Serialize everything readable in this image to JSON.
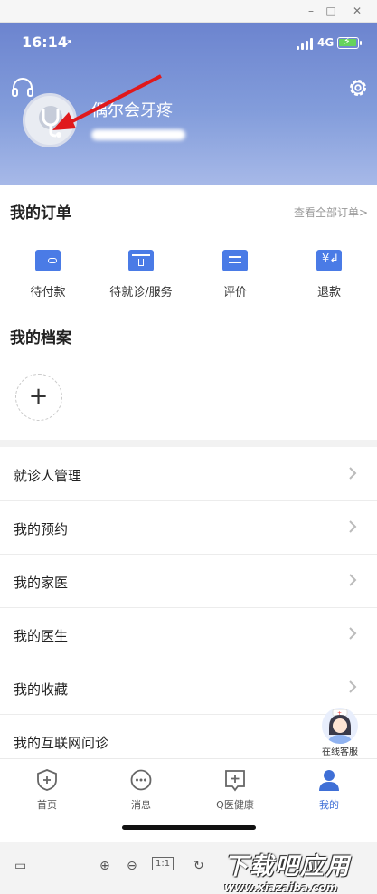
{
  "window": {
    "minimize": "–",
    "maximize": "□",
    "close": "✕"
  },
  "status": {
    "time": "16:14",
    "network": "4G"
  },
  "profile": {
    "name": "偶尔会牙疼"
  },
  "orders": {
    "title": "我的订单",
    "see_all": "查看全部订单>",
    "items": [
      {
        "label": "待付款",
        "icon": "wallet-icon"
      },
      {
        "label": "待就诊/服务",
        "icon": "calendar-icon"
      },
      {
        "label": "评价",
        "icon": "comment-icon"
      },
      {
        "label": "退款",
        "icon": "refund-icon"
      }
    ]
  },
  "records": {
    "title": "我的档案",
    "add": "+"
  },
  "list": [
    "就诊人管理",
    "我的预约",
    "我的家医",
    "我的医生",
    "我的收藏",
    "我的互联网问诊"
  ],
  "service": {
    "label": "在线客服"
  },
  "tabs": [
    {
      "label": "首页",
      "icon": "home-shield-icon",
      "active": false
    },
    {
      "label": "消息",
      "icon": "message-icon",
      "active": false
    },
    {
      "label": "Q医健康",
      "icon": "health-icon",
      "active": false
    },
    {
      "label": "我的",
      "icon": "profile-icon",
      "active": true
    }
  ],
  "viewer": {
    "zoom_reset": "1:1"
  },
  "watermark": {
    "big": "下载吧应用",
    "small": "www.xiazaiba.com"
  },
  "colors": {
    "accent": "#3f6fd6",
    "header": "#7e96d8",
    "arrow": "#e0191c"
  }
}
